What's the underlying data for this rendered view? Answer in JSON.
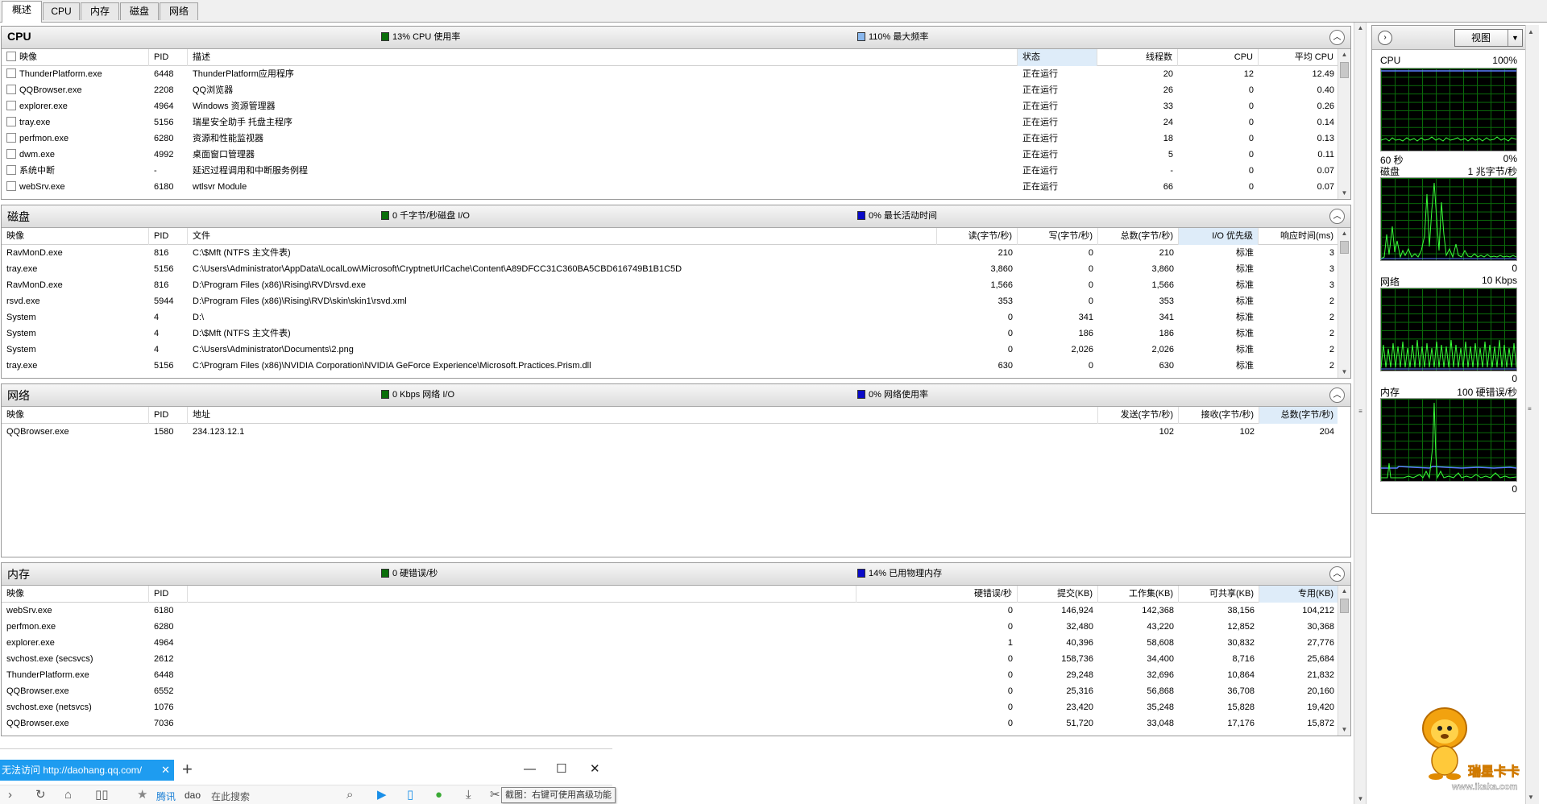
{
  "tabs": [
    "概述",
    "CPU",
    "内存",
    "磁盘",
    "网络"
  ],
  "cpu": {
    "title": "CPU",
    "stat1": "13% CPU 使用率",
    "stat2": "110% 最大频率",
    "columns": [
      "映像",
      "PID",
      "描述",
      "状态",
      "线程数",
      "CPU",
      "平均 CPU"
    ],
    "rows": [
      {
        "name": "ThunderPlatform.exe",
        "pid": "6448",
        "desc": "ThunderPlatform应用程序",
        "status": "正在运行",
        "threads": "20",
        "cpu": "12",
        "avg": "12.49"
      },
      {
        "name": "QQBrowser.exe",
        "pid": "2208",
        "desc": "QQ浏览器",
        "status": "正在运行",
        "threads": "26",
        "cpu": "0",
        "avg": "0.40"
      },
      {
        "name": "explorer.exe",
        "pid": "4964",
        "desc": "Windows 资源管理器",
        "status": "正在运行",
        "threads": "33",
        "cpu": "0",
        "avg": "0.26"
      },
      {
        "name": "tray.exe",
        "pid": "5156",
        "desc": "瑞星安全助手 托盘主程序",
        "status": "正在运行",
        "threads": "24",
        "cpu": "0",
        "avg": "0.14"
      },
      {
        "name": "perfmon.exe",
        "pid": "6280",
        "desc": "资源和性能监视器",
        "status": "正在运行",
        "threads": "18",
        "cpu": "0",
        "avg": "0.13"
      },
      {
        "name": "dwm.exe",
        "pid": "4992",
        "desc": "桌面窗口管理器",
        "status": "正在运行",
        "threads": "5",
        "cpu": "0",
        "avg": "0.11"
      },
      {
        "name": "系统中断",
        "pid": "-",
        "desc": "延迟过程调用和中断服务例程",
        "status": "正在运行",
        "threads": "-",
        "cpu": "0",
        "avg": "0.07"
      },
      {
        "name": "webSrv.exe",
        "pid": "6180",
        "desc": "wtlsvr Module",
        "status": "正在运行",
        "threads": "66",
        "cpu": "0",
        "avg": "0.07"
      }
    ]
  },
  "disk": {
    "title": "磁盘",
    "stat1": "0 千字节/秒磁盘 I/O",
    "stat2": "0% 最长活动时间",
    "columns": [
      "映像",
      "PID",
      "文件",
      "读(字节/秒)",
      "写(字节/秒)",
      "总数(字节/秒)",
      "I/O 优先级",
      "响应时间(ms)"
    ],
    "rows": [
      {
        "name": "RavMonD.exe",
        "pid": "816",
        "file": "C:\\$Mft (NTFS 主文件表)",
        "read": "210",
        "write": "0",
        "total": "210",
        "prio": "标准",
        "resp": "3"
      },
      {
        "name": "tray.exe",
        "pid": "5156",
        "file": "C:\\Users\\Administrator\\AppData\\LocalLow\\Microsoft\\CryptnetUrlCache\\Content\\A89DFCC31C360BA5CBD616749B1B1C5D",
        "read": "3,860",
        "write": "0",
        "total": "3,860",
        "prio": "标准",
        "resp": "3"
      },
      {
        "name": "RavMonD.exe",
        "pid": "816",
        "file": "D:\\Program Files (x86)\\Rising\\RVD\\rsvd.exe",
        "read": "1,566",
        "write": "0",
        "total": "1,566",
        "prio": "标准",
        "resp": "3"
      },
      {
        "name": "rsvd.exe",
        "pid": "5944",
        "file": "D:\\Program Files (x86)\\Rising\\RVD\\skin\\skin1\\rsvd.xml",
        "read": "353",
        "write": "0",
        "total": "353",
        "prio": "标准",
        "resp": "2"
      },
      {
        "name": "System",
        "pid": "4",
        "file": "D:\\",
        "read": "0",
        "write": "341",
        "total": "341",
        "prio": "标准",
        "resp": "2"
      },
      {
        "name": "System",
        "pid": "4",
        "file": "D:\\$Mft (NTFS 主文件表)",
        "read": "0",
        "write": "186",
        "total": "186",
        "prio": "标准",
        "resp": "2"
      },
      {
        "name": "System",
        "pid": "4",
        "file": "C:\\Users\\Administrator\\Documents\\2.png",
        "read": "0",
        "write": "2,026",
        "total": "2,026",
        "prio": "标准",
        "resp": "2"
      },
      {
        "name": "tray.exe",
        "pid": "5156",
        "file": "C:\\Program Files (x86)\\NVIDIA Corporation\\NVIDIA GeForce Experience\\Microsoft.Practices.Prism.dll",
        "read": "630",
        "write": "0",
        "total": "630",
        "prio": "标准",
        "resp": "2"
      }
    ]
  },
  "network": {
    "title": "网络",
    "stat1": "0 Kbps 网络 I/O",
    "stat2": "0% 网络使用率",
    "columns": [
      "映像",
      "PID",
      "地址",
      "发送(字节/秒)",
      "接收(字节/秒)",
      "总数(字节/秒)"
    ],
    "rows": [
      {
        "name": "QQBrowser.exe",
        "pid": "1580",
        "addr": "234.123.12.1",
        "send": "102",
        "recv": "102",
        "total": "204"
      }
    ]
  },
  "memory": {
    "title": "内存",
    "stat1": "0 硬错误/秒",
    "stat2": "14% 已用物理内存",
    "columns": [
      "映像",
      "PID",
      "硬错误/秒",
      "提交(KB)",
      "工作集(KB)",
      "可共享(KB)",
      "专用(KB)"
    ],
    "rows": [
      {
        "name": "webSrv.exe",
        "pid": "6180",
        "hard": "0",
        "commit": "146,924",
        "ws": "142,368",
        "share": "38,156",
        "priv": "104,212"
      },
      {
        "name": "perfmon.exe",
        "pid": "6280",
        "hard": "0",
        "commit": "32,480",
        "ws": "43,220",
        "share": "12,852",
        "priv": "30,368"
      },
      {
        "name": "explorer.exe",
        "pid": "4964",
        "hard": "1",
        "commit": "40,396",
        "ws": "58,608",
        "share": "30,832",
        "priv": "27,776"
      },
      {
        "name": "svchost.exe (secsvcs)",
        "pid": "2612",
        "hard": "0",
        "commit": "158,736",
        "ws": "34,400",
        "share": "8,716",
        "priv": "25,684"
      },
      {
        "name": "ThunderPlatform.exe",
        "pid": "6448",
        "hard": "0",
        "commit": "29,248",
        "ws": "32,696",
        "share": "10,864",
        "priv": "21,832"
      },
      {
        "name": "QQBrowser.exe",
        "pid": "6552",
        "hard": "0",
        "commit": "25,316",
        "ws": "56,868",
        "share": "36,708",
        "priv": "20,160"
      },
      {
        "name": "svchost.exe (netsvcs)",
        "pid": "1076",
        "hard": "0",
        "commit": "23,420",
        "ws": "35,248",
        "share": "15,828",
        "priv": "19,420"
      },
      {
        "name": "QQBrowser.exe",
        "pid": "7036",
        "hard": "0",
        "commit": "51,720",
        "ws": "33,048",
        "share": "17,176",
        "priv": "15,872"
      }
    ]
  },
  "side": {
    "view_label": "视图",
    "monitors": [
      {
        "label": "CPU",
        "right": "100%",
        "botl": "60 秒",
        "botr": "0%"
      },
      {
        "label": "磁盘",
        "right": "1 兆字节/秒",
        "botl": "",
        "botr": "0"
      },
      {
        "label": "网络",
        "right": "10 Kbps",
        "botl": "",
        "botr": "0"
      },
      {
        "label": "内存",
        "right": "100 硬错误/秒",
        "botl": "",
        "botr": "0"
      }
    ]
  },
  "browser": {
    "tab_title": "无法访问 http://daohang.qq.com/",
    "fav_label": "腾讯",
    "search_prefix": "dao",
    "search_placeholder": "在此搜索",
    "tooltip": "截图：右键可使用高级功能"
  },
  "watermark": {
    "brand": "瑞星卡卡",
    "url": "www.ikaka.com"
  },
  "colors": {
    "stat_green": "#0a6e0a",
    "stat_blue": "#0a0ac8",
    "graph_line": "#39ff39",
    "browser_tab": "#1e9cf0"
  }
}
